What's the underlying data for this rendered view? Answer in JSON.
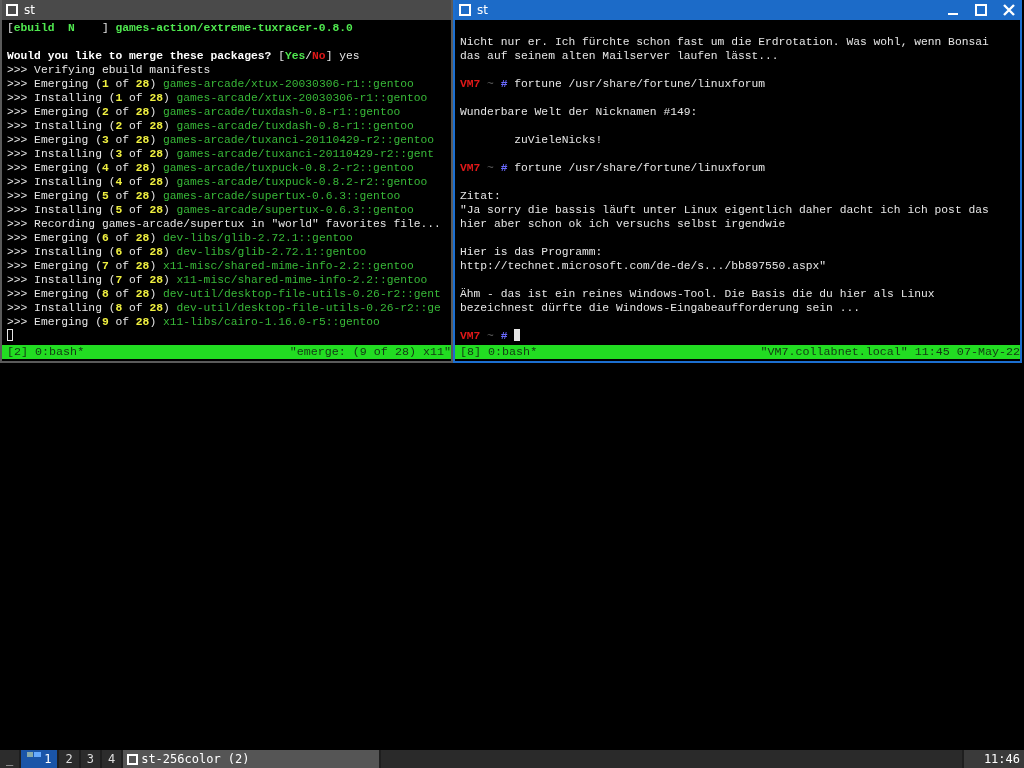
{
  "windows": [
    {
      "title": "st",
      "focused": false,
      "lines": [
        {
          "kind": "text",
          "segments": [
            {
              "kind": "plain",
              "text": "["
            },
            {
              "kind": "bright",
              "text": "ebuild  N"
            },
            {
              "kind": "plain",
              "text": "    ] "
            },
            {
              "kind": "bright",
              "text": "games-action/extreme-tuxracer-0.8.0"
            }
          ]
        },
        {
          "kind": "blank"
        },
        {
          "kind": "text",
          "segments": [
            {
              "kind": "bold",
              "text": "Would you like to merge these packages? "
            },
            {
              "kind": "plain",
              "text": "["
            },
            {
              "kind": "bright",
              "text": "Yes"
            },
            {
              "kind": "plain",
              "text": "/"
            },
            {
              "kind": "red",
              "text": "No"
            },
            {
              "kind": "plain",
              "text": "] yes"
            }
          ]
        },
        {
          "kind": "text",
          "segments": [
            {
              "kind": "plain",
              "text": ">>> Verifying ebuild manifests"
            }
          ]
        },
        {
          "kind": "text",
          "segments": [
            {
              "kind": "plain",
              "text": ">>> Emerging ("
            },
            {
              "kind": "yellow",
              "text": "1"
            },
            {
              "kind": "plain",
              "text": " of "
            },
            {
              "kind": "yellow",
              "text": "28"
            },
            {
              "kind": "plain",
              "text": ") "
            },
            {
              "kind": "green",
              "text": "games-arcade/xtux-20030306-r1::gentoo"
            }
          ]
        },
        {
          "kind": "text",
          "segments": [
            {
              "kind": "plain",
              "text": ">>> Installing ("
            },
            {
              "kind": "yellow",
              "text": "1"
            },
            {
              "kind": "plain",
              "text": " of "
            },
            {
              "kind": "yellow",
              "text": "28"
            },
            {
              "kind": "plain",
              "text": ") "
            },
            {
              "kind": "green",
              "text": "games-arcade/xtux-20030306-r1::gentoo"
            }
          ]
        },
        {
          "kind": "text",
          "segments": [
            {
              "kind": "plain",
              "text": ">>> Emerging ("
            },
            {
              "kind": "yellow",
              "text": "2"
            },
            {
              "kind": "plain",
              "text": " of "
            },
            {
              "kind": "yellow",
              "text": "28"
            },
            {
              "kind": "plain",
              "text": ") "
            },
            {
              "kind": "green",
              "text": "games-arcade/tuxdash-0.8-r1::gentoo"
            }
          ]
        },
        {
          "kind": "text",
          "segments": [
            {
              "kind": "plain",
              "text": ">>> Installing ("
            },
            {
              "kind": "yellow",
              "text": "2"
            },
            {
              "kind": "plain",
              "text": " of "
            },
            {
              "kind": "yellow",
              "text": "28"
            },
            {
              "kind": "plain",
              "text": ") "
            },
            {
              "kind": "green",
              "text": "games-arcade/tuxdash-0.8-r1::gentoo"
            }
          ]
        },
        {
          "kind": "text",
          "segments": [
            {
              "kind": "plain",
              "text": ">>> Emerging ("
            },
            {
              "kind": "yellow",
              "text": "3"
            },
            {
              "kind": "plain",
              "text": " of "
            },
            {
              "kind": "yellow",
              "text": "28"
            },
            {
              "kind": "plain",
              "text": ") "
            },
            {
              "kind": "green",
              "text": "games-arcade/tuxanci-20110429-r2::gentoo"
            }
          ]
        },
        {
          "kind": "text",
          "segments": [
            {
              "kind": "plain",
              "text": ">>> Installing ("
            },
            {
              "kind": "yellow",
              "text": "3"
            },
            {
              "kind": "plain",
              "text": " of "
            },
            {
              "kind": "yellow",
              "text": "28"
            },
            {
              "kind": "plain",
              "text": ") "
            },
            {
              "kind": "green",
              "text": "games-arcade/tuxanci-20110429-r2::gent"
            }
          ]
        },
        {
          "kind": "text",
          "segments": [
            {
              "kind": "plain",
              "text": ">>> Emerging ("
            },
            {
              "kind": "yellow",
              "text": "4"
            },
            {
              "kind": "plain",
              "text": " of "
            },
            {
              "kind": "yellow",
              "text": "28"
            },
            {
              "kind": "plain",
              "text": ") "
            },
            {
              "kind": "green",
              "text": "games-arcade/tuxpuck-0.8.2-r2::gentoo"
            }
          ]
        },
        {
          "kind": "text",
          "segments": [
            {
              "kind": "plain",
              "text": ">>> Installing ("
            },
            {
              "kind": "yellow",
              "text": "4"
            },
            {
              "kind": "plain",
              "text": " of "
            },
            {
              "kind": "yellow",
              "text": "28"
            },
            {
              "kind": "plain",
              "text": ") "
            },
            {
              "kind": "green",
              "text": "games-arcade/tuxpuck-0.8.2-r2::gentoo"
            }
          ]
        },
        {
          "kind": "text",
          "segments": [
            {
              "kind": "plain",
              "text": ">>> Emerging ("
            },
            {
              "kind": "yellow",
              "text": "5"
            },
            {
              "kind": "plain",
              "text": " of "
            },
            {
              "kind": "yellow",
              "text": "28"
            },
            {
              "kind": "plain",
              "text": ") "
            },
            {
              "kind": "green",
              "text": "games-arcade/supertux-0.6.3::gentoo"
            }
          ]
        },
        {
          "kind": "text",
          "segments": [
            {
              "kind": "plain",
              "text": ">>> Installing ("
            },
            {
              "kind": "yellow",
              "text": "5"
            },
            {
              "kind": "plain",
              "text": " of "
            },
            {
              "kind": "yellow",
              "text": "28"
            },
            {
              "kind": "plain",
              "text": ") "
            },
            {
              "kind": "green",
              "text": "games-arcade/supertux-0.6.3::gentoo"
            }
          ]
        },
        {
          "kind": "text",
          "segments": [
            {
              "kind": "plain",
              "text": ">>> Recording games-arcade/supertux in \"world\" favorites file..."
            }
          ]
        },
        {
          "kind": "text",
          "segments": [
            {
              "kind": "plain",
              "text": ">>> Emerging ("
            },
            {
              "kind": "yellow",
              "text": "6"
            },
            {
              "kind": "plain",
              "text": " of "
            },
            {
              "kind": "yellow",
              "text": "28"
            },
            {
              "kind": "plain",
              "text": ") "
            },
            {
              "kind": "green",
              "text": "dev-libs/glib-2.72.1::gentoo"
            }
          ]
        },
        {
          "kind": "text",
          "segments": [
            {
              "kind": "plain",
              "text": ">>> Installing ("
            },
            {
              "kind": "yellow",
              "text": "6"
            },
            {
              "kind": "plain",
              "text": " of "
            },
            {
              "kind": "yellow",
              "text": "28"
            },
            {
              "kind": "plain",
              "text": ") "
            },
            {
              "kind": "green",
              "text": "dev-libs/glib-2.72.1::gentoo"
            }
          ]
        },
        {
          "kind": "text",
          "segments": [
            {
              "kind": "plain",
              "text": ">>> Emerging ("
            },
            {
              "kind": "yellow",
              "text": "7"
            },
            {
              "kind": "plain",
              "text": " of "
            },
            {
              "kind": "yellow",
              "text": "28"
            },
            {
              "kind": "plain",
              "text": ") "
            },
            {
              "kind": "green",
              "text": "x11-misc/shared-mime-info-2.2::gentoo"
            }
          ]
        },
        {
          "kind": "text",
          "segments": [
            {
              "kind": "plain",
              "text": ">>> Installing ("
            },
            {
              "kind": "yellow",
              "text": "7"
            },
            {
              "kind": "plain",
              "text": " of "
            },
            {
              "kind": "yellow",
              "text": "28"
            },
            {
              "kind": "plain",
              "text": ") "
            },
            {
              "kind": "green",
              "text": "x11-misc/shared-mime-info-2.2::gentoo"
            }
          ]
        },
        {
          "kind": "text",
          "segments": [
            {
              "kind": "plain",
              "text": ">>> Emerging ("
            },
            {
              "kind": "yellow",
              "text": "8"
            },
            {
              "kind": "plain",
              "text": " of "
            },
            {
              "kind": "yellow",
              "text": "28"
            },
            {
              "kind": "plain",
              "text": ") "
            },
            {
              "kind": "green",
              "text": "dev-util/desktop-file-utils-0.26-r2::gent"
            }
          ]
        },
        {
          "kind": "text",
          "segments": [
            {
              "kind": "plain",
              "text": ">>> Installing ("
            },
            {
              "kind": "yellow",
              "text": "8"
            },
            {
              "kind": "plain",
              "text": " of "
            },
            {
              "kind": "yellow",
              "text": "28"
            },
            {
              "kind": "plain",
              "text": ") "
            },
            {
              "kind": "green",
              "text": "dev-util/desktop-file-utils-0.26-r2::ge"
            }
          ]
        },
        {
          "kind": "text",
          "segments": [
            {
              "kind": "plain",
              "text": ">>> Emerging ("
            },
            {
              "kind": "yellow",
              "text": "9"
            },
            {
              "kind": "plain",
              "text": " of "
            },
            {
              "kind": "yellow",
              "text": "28"
            },
            {
              "kind": "plain",
              "text": ") "
            },
            {
              "kind": "green",
              "text": "x11-libs/cairo-1.16.0-r5::gentoo"
            }
          ]
        },
        {
          "kind": "text",
          "segments": [
            {
              "kind": "cursor"
            }
          ]
        }
      ],
      "status_left": "[2] 0:bash*",
      "status_right": "\"emerge: (9 of 28) x11\""
    },
    {
      "title": "st",
      "focused": true,
      "lines": [
        {
          "kind": "blank"
        },
        {
          "kind": "text",
          "segments": [
            {
              "kind": "plain",
              "text": "Nicht nur er. Ich fürchte schon fast um die Erdrotation. Was wohl, wenn Bonsai"
            }
          ]
        },
        {
          "kind": "text",
          "segments": [
            {
              "kind": "plain",
              "text": "das auf seinem alten Mailserver laufen lässt..."
            }
          ]
        },
        {
          "kind": "blank"
        },
        {
          "kind": "text",
          "segments": [
            {
              "kind": "red",
              "text": "VM7"
            },
            {
              "kind": "dim",
              "text": " ~ "
            },
            {
              "kind": "purple",
              "text": "#"
            },
            {
              "kind": "plain",
              "text": " fortune /usr/share/fortune/linuxforum"
            }
          ]
        },
        {
          "kind": "blank"
        },
        {
          "kind": "text",
          "segments": [
            {
              "kind": "plain",
              "text": "Wunderbare Welt der Nicknamen #149:"
            }
          ]
        },
        {
          "kind": "blank"
        },
        {
          "kind": "text",
          "segments": [
            {
              "kind": "plain",
              "text": "        zuVieleNicks!"
            }
          ]
        },
        {
          "kind": "blank"
        },
        {
          "kind": "text",
          "segments": [
            {
              "kind": "red",
              "text": "VM7"
            },
            {
              "kind": "dim",
              "text": " ~ "
            },
            {
              "kind": "purple",
              "text": "#"
            },
            {
              "kind": "plain",
              "text": " fortune /usr/share/fortune/linuxforum"
            }
          ]
        },
        {
          "kind": "blank"
        },
        {
          "kind": "text",
          "segments": [
            {
              "kind": "plain",
              "text": "Zitat:"
            }
          ]
        },
        {
          "kind": "text",
          "segments": [
            {
              "kind": "plain",
              "text": "\"Ja sorry die bassis läuft unter Linux eigentlich daher dacht ich ich post das"
            }
          ]
        },
        {
          "kind": "text",
          "segments": [
            {
              "kind": "plain",
              "text": "hier aber schon ok ich versuchs selbst irgendwie"
            }
          ]
        },
        {
          "kind": "blank"
        },
        {
          "kind": "text",
          "segments": [
            {
              "kind": "plain",
              "text": "Hier is das Programm:"
            }
          ]
        },
        {
          "kind": "text",
          "segments": [
            {
              "kind": "plain",
              "text": "http://technet.microsoft.com/de-de/s.../bb897550.aspx\""
            }
          ]
        },
        {
          "kind": "blank"
        },
        {
          "kind": "text",
          "segments": [
            {
              "kind": "plain",
              "text": "Ähm - das ist ein reines Windows-Tool. Die Basis die du hier als Linux"
            }
          ]
        },
        {
          "kind": "text",
          "segments": [
            {
              "kind": "plain",
              "text": "bezeichnest dürfte die Windows-Eingabeaufforderung sein ..."
            }
          ]
        },
        {
          "kind": "blank"
        },
        {
          "kind": "text",
          "segments": [
            {
              "kind": "red",
              "text": "VM7"
            },
            {
              "kind": "dim",
              "text": " ~ "
            },
            {
              "kind": "purple",
              "text": "# "
            },
            {
              "kind": "cursor"
            }
          ]
        }
      ],
      "status_left": "[8] 0:bash*",
      "status_right": "\"VM7.collabnet.local\" 11:45 07-May-22"
    }
  ],
  "taskbar": {
    "menu_label": "_",
    "workspaces": [
      {
        "label": "1",
        "selected": true
      },
      {
        "label": "2",
        "selected": false
      },
      {
        "label": "3",
        "selected": false
      },
      {
        "label": "4",
        "selected": false
      }
    ],
    "tasks": [
      {
        "title": "st-256color (2)"
      }
    ],
    "clock": "11:46"
  }
}
